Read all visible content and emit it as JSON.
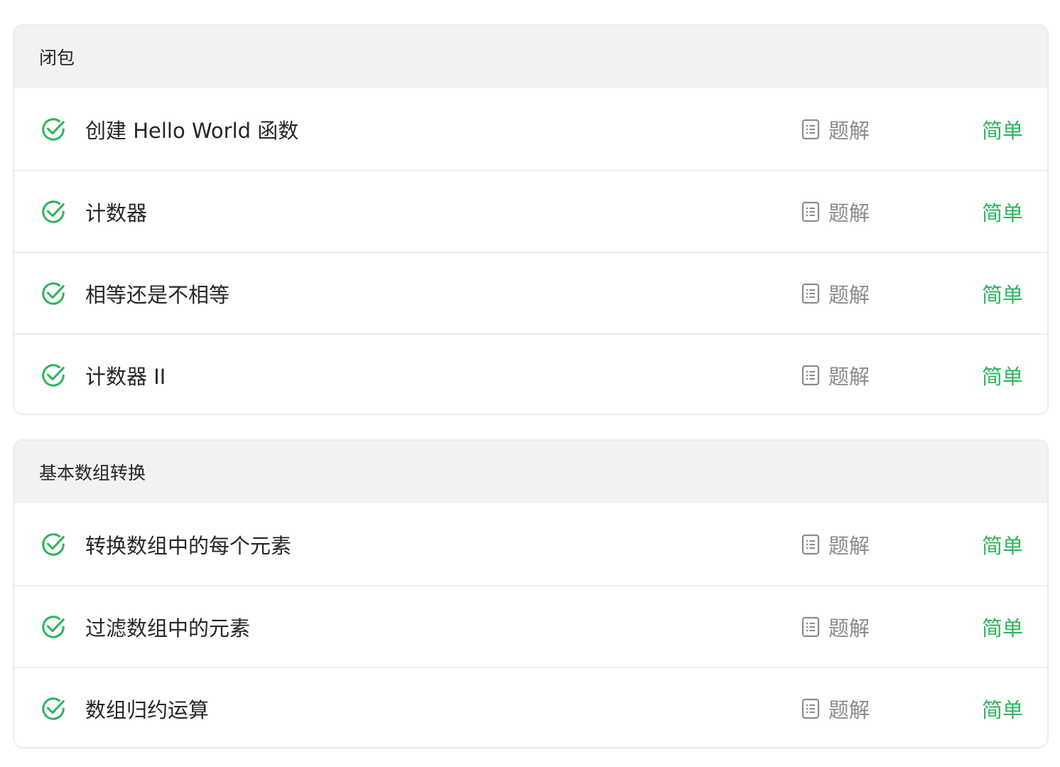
{
  "colors": {
    "check": "#2db55d",
    "difficulty_easy": "#2db55d",
    "muted": "#8c8c8c",
    "header_bg": "#f2f2f2"
  },
  "groups": [
    {
      "header": "闭包",
      "rows": [
        {
          "title": "创建 Hello World 函数",
          "solution": "题解",
          "difficulty": "简单",
          "status_icon": "check-circle-icon",
          "solution_icon": "document-icon"
        },
        {
          "title": "计数器",
          "solution": "题解",
          "difficulty": "简单",
          "status_icon": "check-circle-icon",
          "solution_icon": "document-icon"
        },
        {
          "title": "相等还是不相等",
          "solution": "题解",
          "difficulty": "简单",
          "status_icon": "check-circle-icon",
          "solution_icon": "document-icon"
        },
        {
          "title": "计数器 II",
          "solution": "题解",
          "difficulty": "简单",
          "status_icon": "check-circle-icon",
          "solution_icon": "document-icon"
        }
      ]
    },
    {
      "header": "基本数组转换",
      "rows": [
        {
          "title": "转换数组中的每个元素",
          "solution": "题解",
          "difficulty": "简单",
          "status_icon": "check-circle-icon",
          "solution_icon": "document-icon"
        },
        {
          "title": "过滤数组中的元素",
          "solution": "题解",
          "difficulty": "简单",
          "status_icon": "check-circle-icon",
          "solution_icon": "document-icon"
        },
        {
          "title": "数组归约运算",
          "solution": "题解",
          "difficulty": "简单",
          "status_icon": "check-circle-icon",
          "solution_icon": "document-icon"
        }
      ]
    }
  ]
}
